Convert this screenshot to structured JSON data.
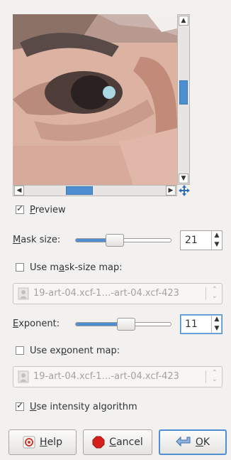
{
  "preview_toggle": {
    "label_prefix": "",
    "mnemonic": "P",
    "label_rest": "review",
    "checked": true
  },
  "mask_size": {
    "mnemonic": "M",
    "label_rest": "ask size:",
    "value": "21",
    "slider_fraction": 0.36
  },
  "use_mask_map": {
    "prefix": "Use m",
    "mnemonic": "a",
    "rest": "sk-size map:",
    "checked": false
  },
  "mask_map_combo": {
    "value": "19-art-04.xcf-1…-art-04.xcf-423",
    "icon": "image-icon"
  },
  "exponent": {
    "mnemonic": "E",
    "label_rest": "xponent:",
    "value": "11",
    "slider_fraction": 0.45
  },
  "use_exponent_map": {
    "prefix": "Use ex",
    "mnemonic": "p",
    "rest": "onent map:",
    "checked": false
  },
  "exponent_map_combo": {
    "value": "19-art-04.xcf-1…-art-04.xcf-423",
    "icon": "image-icon"
  },
  "use_intensity": {
    "prefix": "",
    "mnemonic": "U",
    "rest": "se intensity algorithm",
    "checked": true
  },
  "buttons": {
    "help": {
      "mnemonic": "H",
      "rest": "elp"
    },
    "cancel": {
      "mnemonic": "C",
      "rest": "ancel"
    },
    "ok": {
      "mnemonic": "O",
      "rest": "K"
    }
  },
  "accent_color": "#4d8fd1"
}
